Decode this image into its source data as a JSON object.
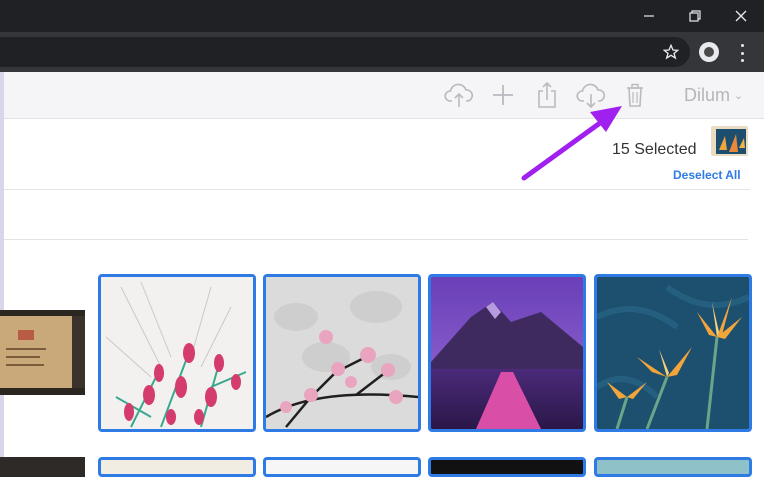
{
  "window": {
    "controls": [
      "minimize",
      "restore",
      "close"
    ]
  },
  "browser": {
    "icons": [
      "star-icon",
      "extension-icon",
      "menu-icon"
    ]
  },
  "toolbar": {
    "icons": [
      "upload-cloud-icon",
      "add-icon",
      "share-icon",
      "download-cloud-icon",
      "trash-icon"
    ],
    "user": {
      "name": "Dilum"
    }
  },
  "selection": {
    "count_label": "15 Selected",
    "deselect_label": "Deselect All"
  },
  "photos": {
    "row1": [
      "document-photo",
      "floral-pink-photo",
      "blossom-branch-photo",
      "mountain-lavender-photo",
      "bird-of-paradise-photo"
    ],
    "row2_count": 5
  },
  "colors": {
    "chrome_dark": "#202124",
    "toolbar_bg": "#f5f5f7",
    "accent_blue": "#2f7be6",
    "annotation_arrow": "#a020f0"
  }
}
